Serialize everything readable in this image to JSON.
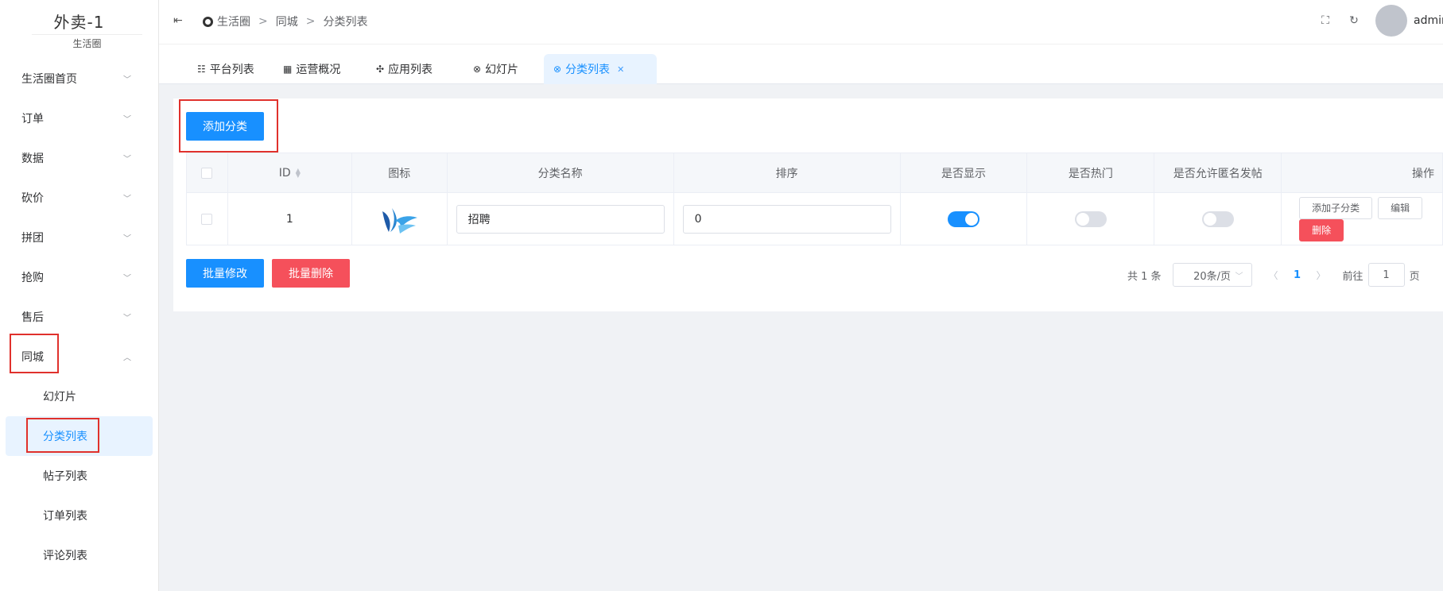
{
  "brand": {
    "title": "外卖-1",
    "subtitle": "生活圈"
  },
  "sidebar": {
    "items": [
      {
        "label": "生活圈首页",
        "chevron": "chevron-down-icon"
      },
      {
        "label": "订单",
        "chevron": "chevron-down-icon"
      },
      {
        "label": "数据",
        "chevron": "chevron-down-icon"
      },
      {
        "label": "砍价",
        "chevron": "chevron-down-icon"
      },
      {
        "label": "拼团",
        "chevron": "chevron-down-icon"
      },
      {
        "label": "抢购",
        "chevron": "chevron-down-icon"
      },
      {
        "label": "售后",
        "chevron": "chevron-down-icon"
      },
      {
        "label": "同城",
        "chevron": "chevron-up-icon",
        "expanded": true
      }
    ],
    "submenu": [
      {
        "label": "幻灯片"
      },
      {
        "label": "分类列表",
        "active": true
      },
      {
        "label": "帖子列表"
      },
      {
        "label": "订单列表"
      },
      {
        "label": "评论列表"
      }
    ]
  },
  "header": {
    "breadcrumb": [
      "生活圈",
      "同城",
      "分类列表"
    ],
    "separator": ">",
    "user": "admin"
  },
  "tabs": [
    {
      "label": "平台列表",
      "icon": "list-icon"
    },
    {
      "label": "运营概况",
      "icon": "grid-icon"
    },
    {
      "label": "应用列表",
      "icon": "apps-icon"
    },
    {
      "label": "幻灯片",
      "icon": "lifebuoy-icon"
    },
    {
      "label": "分类列表",
      "icon": "lifebuoy-icon",
      "active": true,
      "closable": true
    }
  ],
  "toolbar": {
    "add_label": "添加分类"
  },
  "table": {
    "columns": [
      "ID",
      "图标",
      "分类名称",
      "排序",
      "是否显示",
      "是否热门",
      "是否允许匿名发帖",
      "操作"
    ],
    "rows": [
      {
        "id": "1",
        "name": "招聘",
        "sort": "0",
        "show": true,
        "hot": false,
        "anonymous": false,
        "actions": [
          "添加子分类",
          "编辑",
          "删除"
        ]
      }
    ]
  },
  "footer": {
    "batch_edit": "批量修改",
    "batch_delete": "批量删除"
  },
  "pagination": {
    "total_text": "共 1 条",
    "page_size": "20条/页",
    "current_page": "1",
    "goto_label": "前往",
    "goto_value": "1",
    "page_suffix": "页"
  },
  "colors": {
    "primary": "#1890ff",
    "danger": "#f5505b",
    "highlight_box": "#e0312c"
  }
}
